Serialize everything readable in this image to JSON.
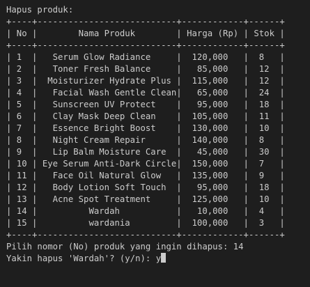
{
  "terminal": {
    "header": "Hapus produk:",
    "table": {
      "border": "+----+---------------------------+------------+------+",
      "header_row": "| No |        Nama Produk        | Harga (Rp) | Stok |",
      "rows": [
        "| 1  |   Serum Glow Radiance     |  120,000   |  8   |",
        "| 2  |   Toner Fresh Balance     |   85,000   |  12  |",
        "| 3  |  Moisturizer Hydrate Plus |  115,000   |  12  |",
        "| 4  |   Facial Wash Gentle Clean|   65,000   |  24  |",
        "| 5  |   Sunscreen UV Protect    |   95,000   |  18  |",
        "| 6  |   Clay Mask Deep Clean    |  105,000   |  11  |",
        "| 7  |   Essence Bright Boost    |  130,000   |  10  |",
        "| 8  |   Night Cream Repair      |  140,000   |  8   |",
        "| 9  |   Lip Balm Moisture Care  |   45,000   |  30  |",
        "| 10 | Eye Serum Anti-Dark Circle|  150,000   |  7   |",
        "| 11 |   Face Oil Natural Glow   |  135,000   |  9   |",
        "| 12 |   Body Lotion Soft Touch  |   95,000   |  18  |",
        "| 13 |   Acne Spot Treatment     |  125,000   |  10  |",
        "| 14 |          Wardah           |   10,000   |  4   |",
        "| 15 |          wardania         |  100,000   |  3   |"
      ]
    },
    "prompt_select": "Pilih nomor (No) produk yang ingin dihapus: 14",
    "prompt_confirm": "Yakin hapus 'Wardah'? (y/n): y"
  }
}
